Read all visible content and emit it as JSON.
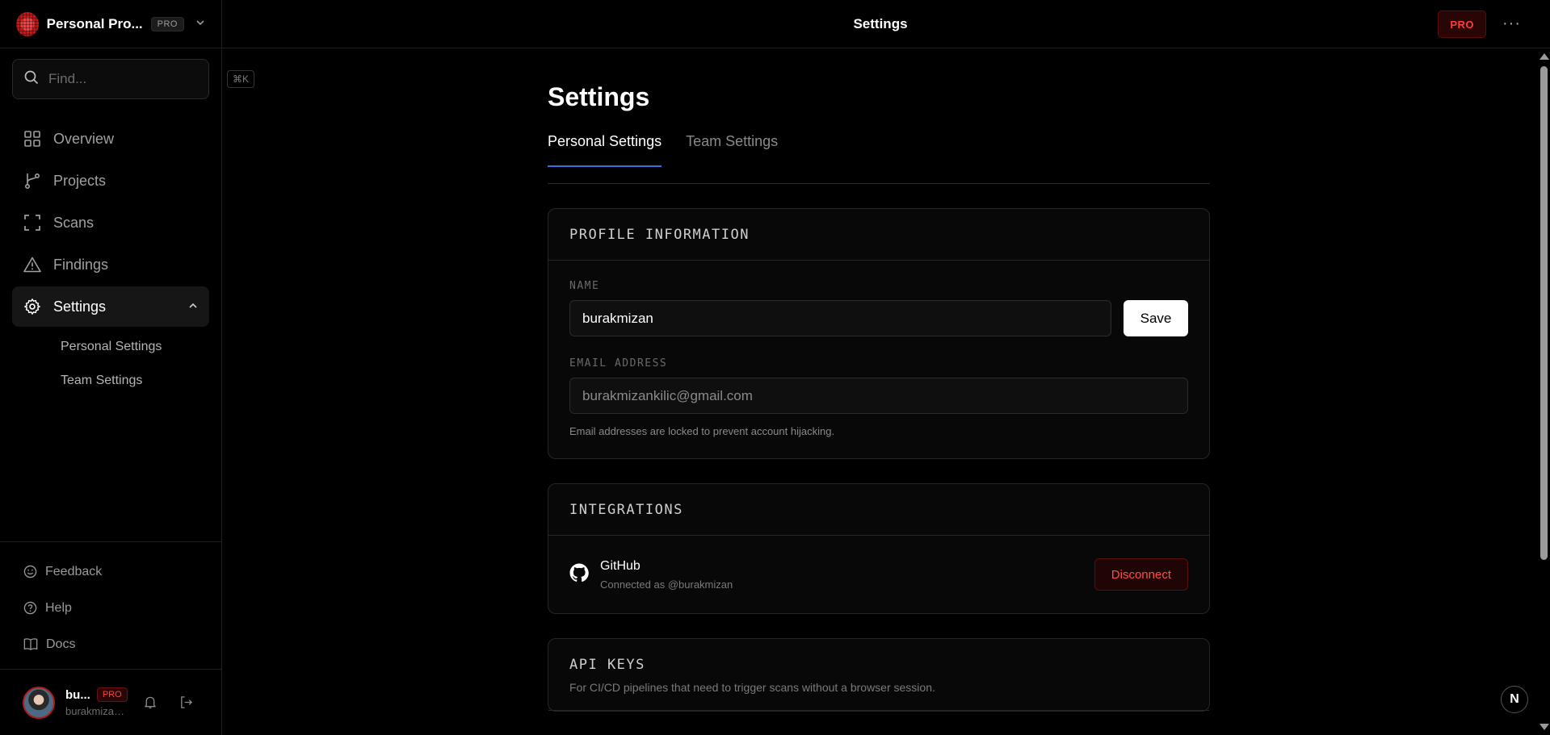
{
  "team": {
    "name": "Personal Pro...",
    "badge": "PRO"
  },
  "search": {
    "placeholder": "Find...",
    "shortcut": "⌘K"
  },
  "nav": {
    "items": [
      {
        "label": "Overview",
        "icon": "grid-icon"
      },
      {
        "label": "Projects",
        "icon": "git-branch-icon"
      },
      {
        "label": "Scans",
        "icon": "scan-icon"
      },
      {
        "label": "Findings",
        "icon": "warning-icon"
      },
      {
        "label": "Settings",
        "icon": "gear-icon"
      }
    ],
    "settings_sub": [
      "Personal Settings",
      "Team Settings"
    ]
  },
  "utilities": [
    {
      "label": "Feedback",
      "icon": "smile-icon"
    },
    {
      "label": "Help",
      "icon": "help-circle-icon"
    },
    {
      "label": "Docs",
      "icon": "book-icon"
    }
  ],
  "user": {
    "name": "bu...",
    "badge": "PRO",
    "email": "burakmizan..."
  },
  "topbar": {
    "title": "Settings",
    "pro_label": "PRO",
    "more": "···"
  },
  "page": {
    "title": "Settings",
    "tabs": [
      "Personal Settings",
      "Team Settings"
    ],
    "active_tab": "Personal Settings"
  },
  "profile": {
    "heading": "PROFILE INFORMATION",
    "name_label": "NAME",
    "name_value": "burakmizan",
    "save_label": "Save",
    "email_label": "EMAIL ADDRESS",
    "email_value": "burakmizankilic@gmail.com",
    "email_help": "Email addresses are locked to prevent account hijacking."
  },
  "integrations": {
    "heading": "INTEGRATIONS",
    "items": [
      {
        "name": "GitHub",
        "status": "Connected as @burakmizan",
        "action": "Disconnect",
        "icon": "github-icon"
      }
    ]
  },
  "api_keys": {
    "heading": "API KEYS",
    "description": "For CI/CD pipelines that need to trigger scans without a browser session."
  },
  "floating_badge": "N",
  "colors": {
    "accent": "#3b6fe0",
    "danger": "#ff4040",
    "background": "#000000"
  }
}
